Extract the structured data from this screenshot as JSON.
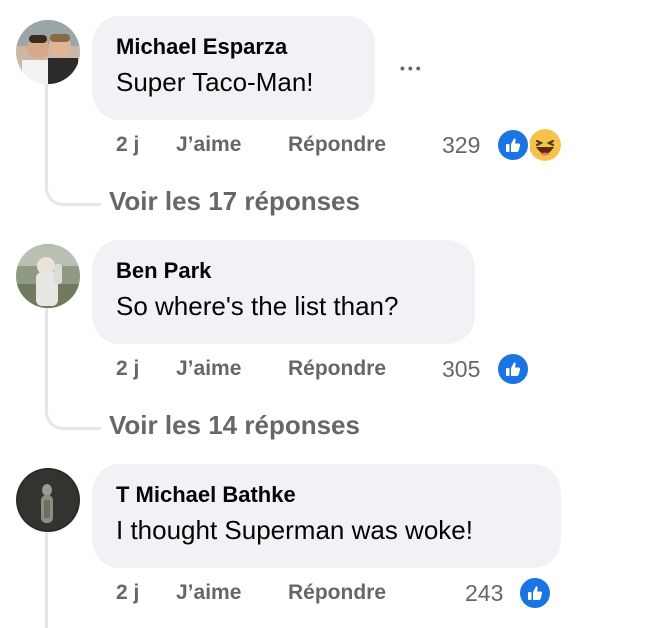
{
  "comments": [
    {
      "author": "Michael Esparza",
      "text": "Super Taco-Man!",
      "time": "2 j",
      "like_label": "J’aime",
      "reply_label": "Répondre",
      "reaction_count": "329",
      "reactions": [
        "like-icon",
        "haha-icon"
      ],
      "more_label": "•••",
      "view_replies": "Voir les 17 réponses"
    },
    {
      "author": "Ben Park",
      "text": "So where's the list than?",
      "time": "2 j",
      "like_label": "J’aime",
      "reply_label": "Répondre",
      "reaction_count": "305",
      "reactions": [
        "like-icon"
      ],
      "view_replies": "Voir les 14 réponses"
    },
    {
      "author": "T Michael Bathke",
      "text": "I thought Superman was woke!",
      "time": "2 j",
      "like_label": "J’aime",
      "reply_label": "Répondre",
      "reaction_count": "243",
      "reactions": [
        "like-icon"
      ]
    }
  ],
  "colors": {
    "bubble": "#f0f2f5",
    "secondary_text": "#65676b",
    "like_blue": "#1b74e4",
    "thread_line": "#e4e6eb"
  }
}
